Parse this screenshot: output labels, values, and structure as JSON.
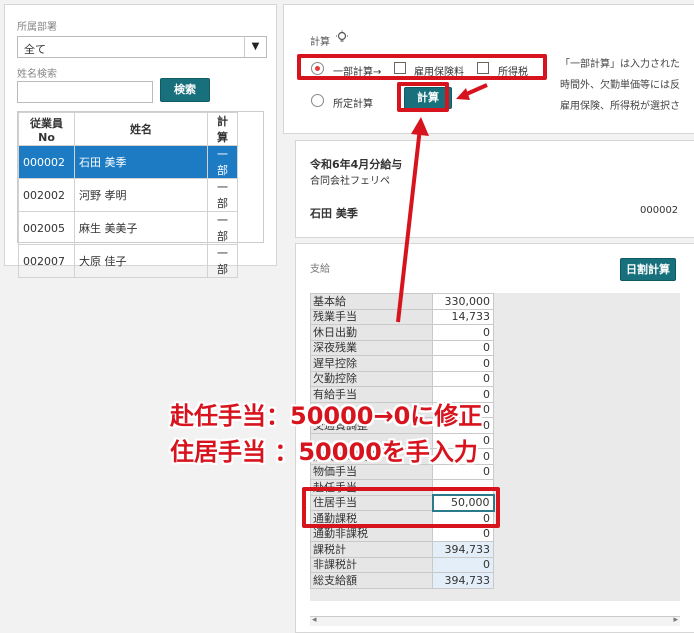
{
  "filters": {
    "dept_label": "所属部署",
    "dept_value": "全て",
    "dept_arrow": "▼",
    "name_label": "姓名検索",
    "name_value": "",
    "search_button": "検索"
  },
  "employee_table": {
    "headers": [
      "従業員No",
      "姓名",
      "計算"
    ],
    "rows": [
      {
        "no": "000002",
        "name": "石田 美季",
        "calc": "一部"
      },
      {
        "no": "002002",
        "name": "河野 孝明",
        "calc": "一部"
      },
      {
        "no": "002005",
        "name": "麻生 美美子",
        "calc": "一部"
      },
      {
        "no": "002007",
        "name": "大原 佳子",
        "calc": "一部"
      }
    ]
  },
  "calc": {
    "title": "計算",
    "partial_label": "一部計算→",
    "employment_insurance_label": "雇用保険料",
    "income_tax_label": "所得税",
    "fixed_label": "所定計算",
    "calc_button": "計算",
    "info_lines": [
      "「一部計算」は入力された",
      "時間外、欠勤単価等には反",
      "雇用保険、所得税が選択さ"
    ]
  },
  "payslip": {
    "title": "令和6年4月分給与",
    "company": "合同会社フェリペ",
    "employee_name": "石田 美季",
    "employee_no": "000002"
  },
  "pay": {
    "section_label": "支給",
    "daily_button": "日割計算",
    "rows": [
      {
        "label": "基本給",
        "value": "330,000"
      },
      {
        "label": "残業手当",
        "value": "14,733"
      },
      {
        "label": "休日出勤",
        "value": "0"
      },
      {
        "label": "深夜残業",
        "value": "0"
      },
      {
        "label": "遅早控除",
        "value": "0"
      },
      {
        "label": "欠勤控除",
        "value": "0"
      },
      {
        "label": "有給手当",
        "value": "0"
      },
      {
        "label": "",
        "value": "0"
      },
      {
        "label": "交通費調整",
        "value": "0"
      },
      {
        "label": "",
        "value": "0"
      },
      {
        "label": "店長/SV手当",
        "value": "0"
      },
      {
        "label": "物価手当",
        "value": "0"
      },
      {
        "label": "赴任手当",
        "value": ""
      },
      {
        "label": "住居手当",
        "value": "50,000"
      },
      {
        "label": "通勤課税",
        "value": "0"
      },
      {
        "label": "通勤非課税",
        "value": "0"
      },
      {
        "label": "課税計",
        "value": "394,733"
      },
      {
        "label": "非課税計",
        "value": "0"
      },
      {
        "label": "総支給額",
        "value": "394,733"
      }
    ]
  },
  "annotations": {
    "line1": "赴任手当：50000→0に修正",
    "line2": "住居手当 ：50000を手入力"
  },
  "scroll": {
    "left": "◂",
    "right": "▸"
  },
  "colors": {
    "accent_teal": "#17707c",
    "selection_blue": "#1c7bc3",
    "annotation_red": "#d7141e"
  }
}
